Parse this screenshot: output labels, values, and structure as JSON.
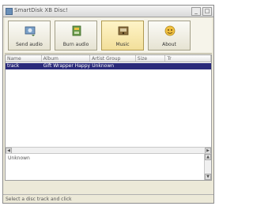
{
  "window": {
    "title": "SmartDisk XB Disc!",
    "controls": [
      "_",
      "□"
    ]
  },
  "toolbar": {
    "buttons": [
      {
        "label": "Send audio",
        "icon": "send-audio-icon"
      },
      {
        "label": "Burn audio",
        "icon": "burn-audio-icon"
      },
      {
        "label": "Music",
        "icon": "music-icon"
      },
      {
        "label": "About",
        "icon": "about-icon"
      }
    ]
  },
  "list": {
    "columns": [
      "Name",
      "Album",
      "Artist Group",
      "Size",
      "Tr"
    ],
    "rows": [
      {
        "cells": [
          "track",
          "Gift Wrapper Happy",
          "Unknown",
          "",
          ""
        ]
      }
    ],
    "selected_row": 0
  },
  "status_area": {
    "text": "Unknown"
  },
  "statusbar": {
    "text": "Select a disc track and click"
  },
  "colors": {
    "selection": "#2a2a7a",
    "active_button": "#f2df9a"
  }
}
